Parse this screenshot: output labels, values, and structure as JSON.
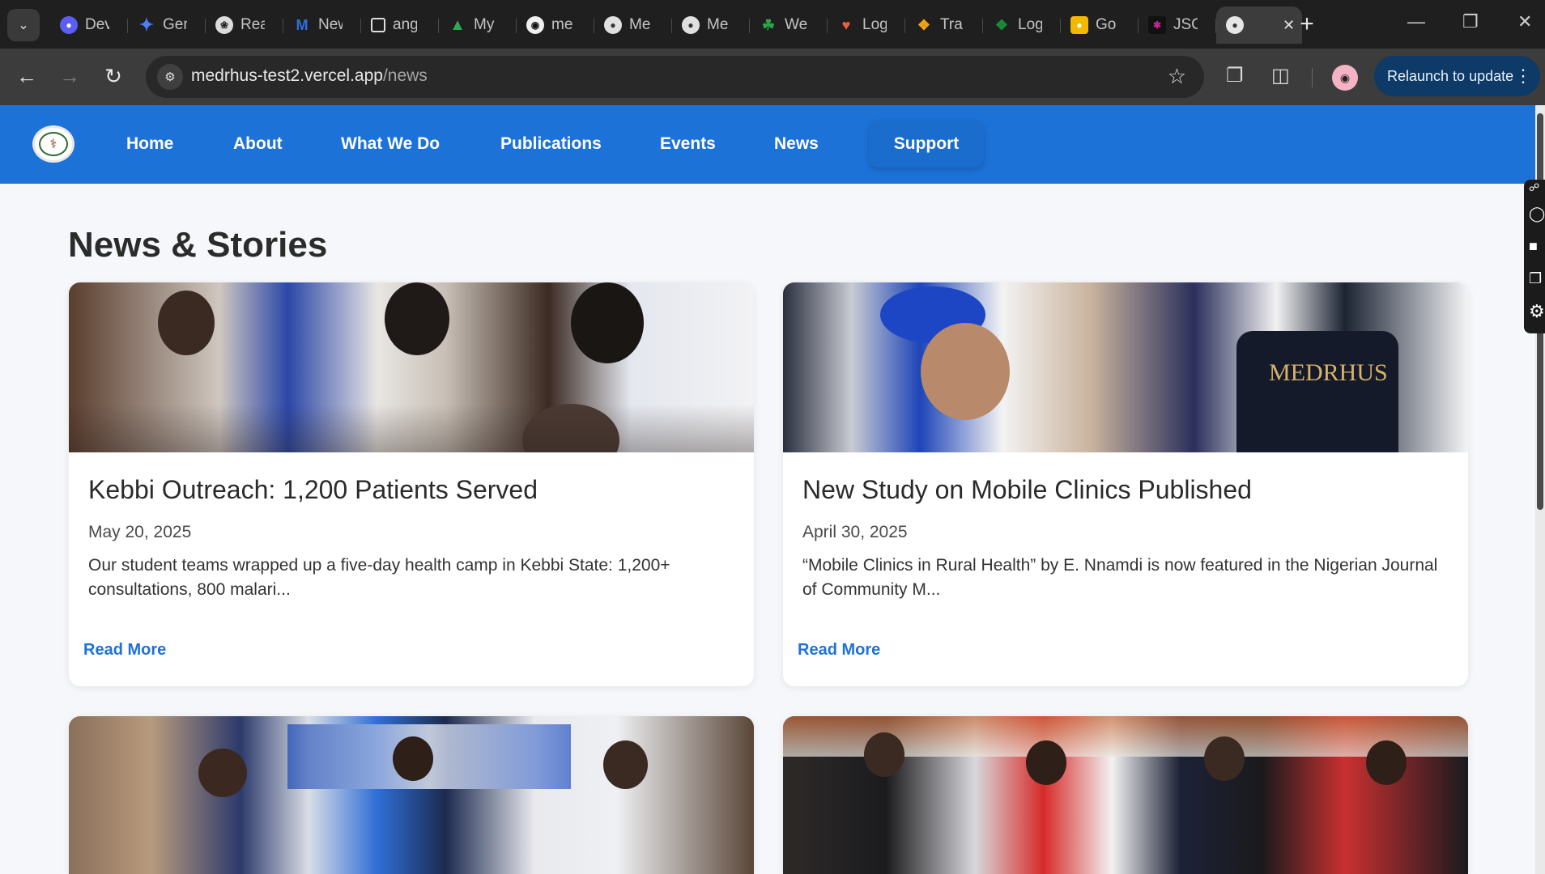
{
  "browser": {
    "tabs": [
      {
        "title": "Dev",
        "color": "#5b5ef5"
      },
      {
        "title": "Gem",
        "color": "#4d7cf5"
      },
      {
        "title": "Rea",
        "color": "#dcdcdc"
      },
      {
        "title": "New",
        "color": "#2d6ee0"
      },
      {
        "title": "ang",
        "color": "#3a3a3a"
      },
      {
        "title": "My",
        "color": "#30a853"
      },
      {
        "title": "me",
        "color": "#f0f0f0"
      },
      {
        "title": "Me",
        "color": "#e0e0e0"
      },
      {
        "title": "Me",
        "color": "#e0e0e0"
      },
      {
        "title": "We",
        "color": "#2fa24c"
      },
      {
        "title": "Log",
        "color": "#e8603c"
      },
      {
        "title": "Tra",
        "color": "#f2a516"
      },
      {
        "title": "Log",
        "color": "#1b8b3a"
      },
      {
        "title": "Go",
        "color": "#f5b800"
      },
      {
        "title": "JSC",
        "color": "#c4258a"
      }
    ],
    "address": {
      "host": "medrhus-test2.vercel.app",
      "path": "/news"
    },
    "relaunch_label": "Relaunch to update"
  },
  "nav": {
    "items": [
      "Home",
      "About",
      "What We Do",
      "Publications",
      "Events",
      "News"
    ],
    "support_label": "Support"
  },
  "page": {
    "title": "News & Stories",
    "cards": [
      {
        "title": "Kebbi Outreach: 1,200 Patients Served",
        "date": "May 20, 2025",
        "excerpt": "Our student teams wrapped up a five-day health camp in Kebbi State: 1,200+ consultations, 800 malari...",
        "link": "Read More"
      },
      {
        "title": "New Study on Mobile Clinics Published",
        "date": "April 30, 2025",
        "excerpt": "“Mobile Clinics in Rural Health” by E. Nnamdi is now featured in the Nigerian Journal of Community M...",
        "link": "Read More"
      },
      {
        "title": "",
        "date": "",
        "excerpt": "",
        "link": ""
      },
      {
        "title": "",
        "date": "",
        "excerpt": "",
        "link": ""
      }
    ]
  },
  "colors": {
    "brand_blue": "#1d72d8",
    "link_blue": "#1d72d8"
  }
}
